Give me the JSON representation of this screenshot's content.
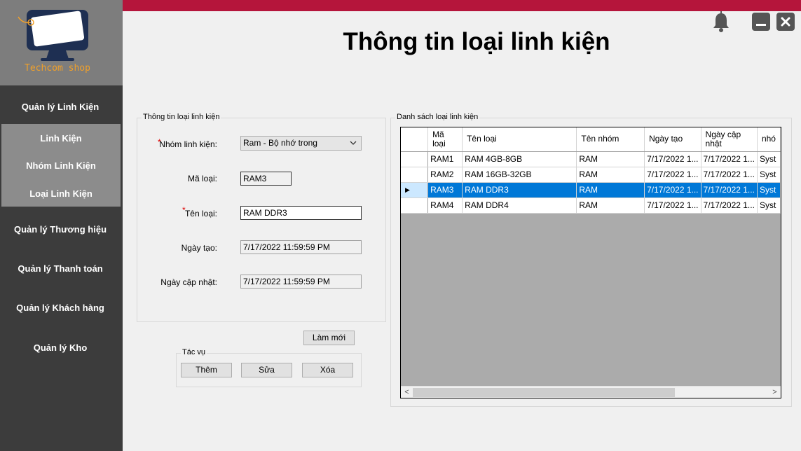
{
  "logo": {
    "text": "Techcom shop"
  },
  "sidebar": {
    "items": [
      {
        "label": "Quản lý Linh Kiện"
      },
      {
        "label": "Quản lý Thương hiệu"
      },
      {
        "label": "Quản lý Thanh toán"
      },
      {
        "label": "Quản lý Khách hàng"
      },
      {
        "label": "Quản lý Kho"
      }
    ],
    "submenu": [
      {
        "label": "Linh Kiện"
      },
      {
        "label": "Nhóm Linh Kiện"
      },
      {
        "label": "Loại Linh Kiện"
      }
    ]
  },
  "header": {
    "title": "Thông tin loại linh kiện"
  },
  "icons": {
    "bell": "bell-icon",
    "minimize": "minimize-icon",
    "close": "close-icon"
  },
  "colors": {
    "top_bar": "#b5153b",
    "sidebar": "#3c3c3c",
    "selection": "#0078d7"
  },
  "info_group": {
    "legend": "Thông tin loại linh kiện",
    "group_label": "Nhóm linh kiện:",
    "group_value": "Ram - Bộ nhớ trong",
    "code_label": "Mã loại:",
    "code_value": "RAM3",
    "name_label": "Tên loại:",
    "name_value": "RAM DDR3",
    "created_label": "Ngày tạo:",
    "created_value": "7/17/2022 11:59:59 PM",
    "updated_label": "Ngày cập nhật:",
    "updated_value": "7/17/2022 11:59:59 PM",
    "required_mark": "*"
  },
  "refresh_button": "Làm mới",
  "actions": {
    "legend": "Tác vụ",
    "add": "Thêm",
    "edit": "Sửa",
    "delete": "Xóa"
  },
  "list_group": {
    "legend": "Danh sách loại linh kiện",
    "columns": [
      "Mã\nloại",
      "Tên loại",
      "Tên nhóm",
      "Ngày tạo",
      "Ngày cập\nnhật",
      "nhó"
    ],
    "rows": [
      [
        "RAM1",
        "RAM 4GB-8GB",
        "RAM",
        "7/17/2022 1...",
        "7/17/2022 1...",
        "Syst"
      ],
      [
        "RAM2",
        "RAM 16GB-32GB",
        "RAM",
        "7/17/2022 1...",
        "7/17/2022 1...",
        "Syst"
      ],
      [
        "RAM3",
        "RAM DDR3",
        "RAM",
        "7/17/2022 1...",
        "7/17/2022 1...",
        "Syst"
      ],
      [
        "RAM4",
        "RAM DDR4",
        "RAM",
        "7/17/2022 1...",
        "7/17/2022 1...",
        "Syst"
      ]
    ],
    "selected_row": 2,
    "current_row_marker": "▶",
    "scroll_left": "<",
    "scroll_right": ">"
  }
}
